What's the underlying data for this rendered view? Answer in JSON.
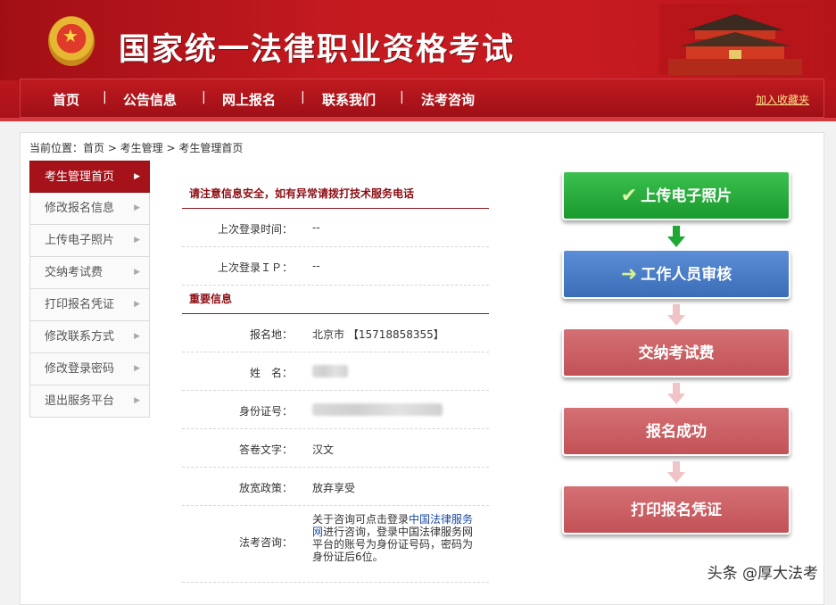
{
  "header": {
    "site_title": "国家统一法律职业资格考试",
    "nav": [
      "首页",
      "公告信息",
      "网上报名",
      "联系我们",
      "法考咨询"
    ],
    "fav_link": "加入收藏夹"
  },
  "breadcrumb": "当前位置：首页 > 考生管理 > 考生管理首页",
  "sidebar": {
    "items": [
      {
        "label": "考生管理首页"
      },
      {
        "label": "修改报名信息"
      },
      {
        "label": "上传电子照片"
      },
      {
        "label": "交纳考试费"
      },
      {
        "label": "打印报名凭证"
      },
      {
        "label": "修改联系方式"
      },
      {
        "label": "修改登录密码"
      },
      {
        "label": "退出服务平台"
      }
    ]
  },
  "info": {
    "notice": "请注意信息安全，如有异常请拨打技术服务电话",
    "last_login_time_label": "上次登录时间：",
    "last_login_time": "--",
    "last_login_ip_label": "上次登录ＩＰ：",
    "last_login_ip": "--",
    "section_title": "重要信息",
    "reg_place_label": "报名地：",
    "reg_place": "北京市 【15718858355】",
    "name_label": "姓　名：",
    "id_label": "身份证号：",
    "lang_label": "答卷文字：",
    "lang": "汉文",
    "policy_label": "放宽政策：",
    "policy": "放弃享受",
    "consult_label": "法考咨询：",
    "consult_pre": "关于咨询可点击登录",
    "consult_link": "中国法律服务网",
    "consult_post": "进行咨询，登录中国法律服务网平台的账号为身份证号码，密码为身份证后6位。"
  },
  "flow": [
    {
      "label": "上传电子照片",
      "icon": "check-icon",
      "color": "#1ea934"
    },
    {
      "label": "工作人员审核",
      "icon": "arrow-right-icon",
      "color": "#4a7cc6"
    },
    {
      "label": "交纳考试费",
      "color": "#c9595e"
    },
    {
      "label": "报名成功",
      "color": "#c9595e"
    },
    {
      "label": "打印报名凭证",
      "color": "#c9595e"
    }
  ],
  "watermark": "头条 @厚大法考"
}
